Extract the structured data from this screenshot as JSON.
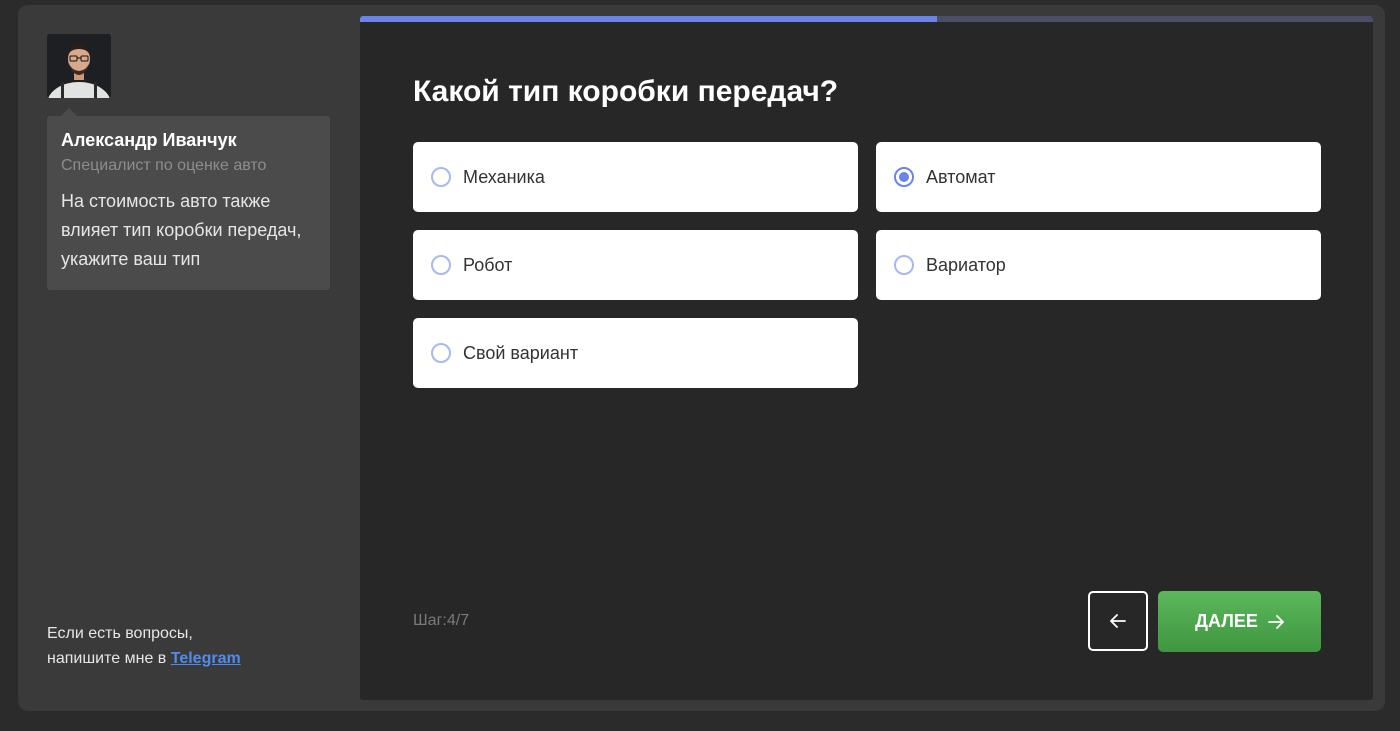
{
  "expert": {
    "name": "Александр Иванчук",
    "role": "Специалист по оценке авто",
    "message": "На стоимость авто также влияет тип коробки передач, укажите ваш тип"
  },
  "help": {
    "line1": "Если есть вопросы,",
    "line2_prefix": "напишите мне в ",
    "link_label": "Telegram"
  },
  "quiz": {
    "progress": 0.57,
    "question": "Какой тип коробки передач?",
    "options": [
      {
        "label": "Механика",
        "selected": false
      },
      {
        "label": "Автомат",
        "selected": true
      },
      {
        "label": "Робот",
        "selected": false
      },
      {
        "label": "Вариатор",
        "selected": false
      },
      {
        "label": "Свой вариант",
        "selected": false
      }
    ],
    "step_text": "Шаг:4/7",
    "next_label": "ДАЛЕЕ"
  },
  "icons": {
    "back": "arrow-left-icon",
    "next": "arrow-right-icon"
  },
  "colors": {
    "accent": "#6a84e8",
    "next_button": "#4caf50",
    "link": "#4f8cf0"
  }
}
